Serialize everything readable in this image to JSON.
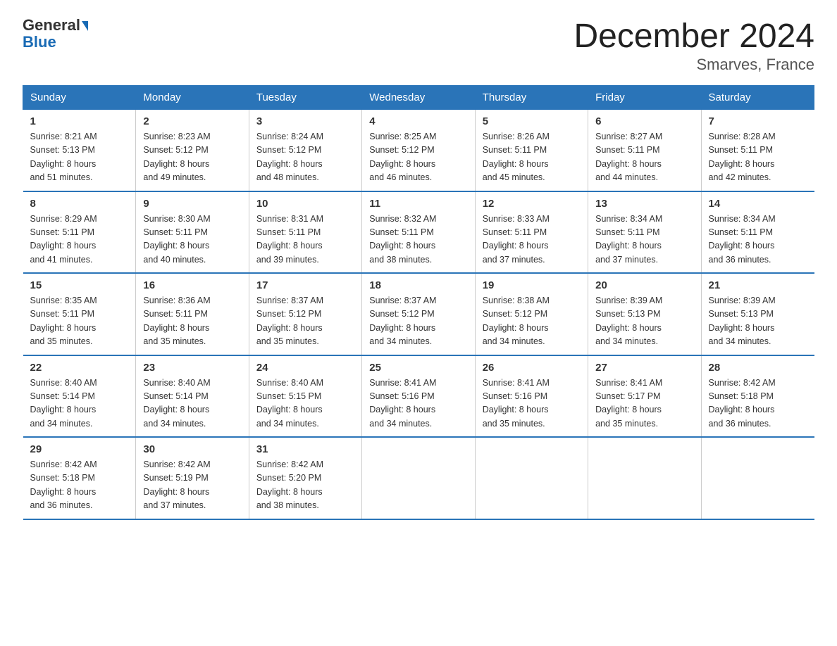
{
  "logo": {
    "line1": "General",
    "line2": "Blue"
  },
  "title": "December 2024",
  "subtitle": "Smarves, France",
  "days_of_week": [
    "Sunday",
    "Monday",
    "Tuesday",
    "Wednesday",
    "Thursday",
    "Friday",
    "Saturday"
  ],
  "weeks": [
    [
      {
        "num": "1",
        "sunrise": "8:21 AM",
        "sunset": "5:13 PM",
        "daylight": "8 hours and 51 minutes."
      },
      {
        "num": "2",
        "sunrise": "8:23 AM",
        "sunset": "5:12 PM",
        "daylight": "8 hours and 49 minutes."
      },
      {
        "num": "3",
        "sunrise": "8:24 AM",
        "sunset": "5:12 PM",
        "daylight": "8 hours and 48 minutes."
      },
      {
        "num": "4",
        "sunrise": "8:25 AM",
        "sunset": "5:12 PM",
        "daylight": "8 hours and 46 minutes."
      },
      {
        "num": "5",
        "sunrise": "8:26 AM",
        "sunset": "5:11 PM",
        "daylight": "8 hours and 45 minutes."
      },
      {
        "num": "6",
        "sunrise": "8:27 AM",
        "sunset": "5:11 PM",
        "daylight": "8 hours and 44 minutes."
      },
      {
        "num": "7",
        "sunrise": "8:28 AM",
        "sunset": "5:11 PM",
        "daylight": "8 hours and 42 minutes."
      }
    ],
    [
      {
        "num": "8",
        "sunrise": "8:29 AM",
        "sunset": "5:11 PM",
        "daylight": "8 hours and 41 minutes."
      },
      {
        "num": "9",
        "sunrise": "8:30 AM",
        "sunset": "5:11 PM",
        "daylight": "8 hours and 40 minutes."
      },
      {
        "num": "10",
        "sunrise": "8:31 AM",
        "sunset": "5:11 PM",
        "daylight": "8 hours and 39 minutes."
      },
      {
        "num": "11",
        "sunrise": "8:32 AM",
        "sunset": "5:11 PM",
        "daylight": "8 hours and 38 minutes."
      },
      {
        "num": "12",
        "sunrise": "8:33 AM",
        "sunset": "5:11 PM",
        "daylight": "8 hours and 37 minutes."
      },
      {
        "num": "13",
        "sunrise": "8:34 AM",
        "sunset": "5:11 PM",
        "daylight": "8 hours and 37 minutes."
      },
      {
        "num": "14",
        "sunrise": "8:34 AM",
        "sunset": "5:11 PM",
        "daylight": "8 hours and 36 minutes."
      }
    ],
    [
      {
        "num": "15",
        "sunrise": "8:35 AM",
        "sunset": "5:11 PM",
        "daylight": "8 hours and 35 minutes."
      },
      {
        "num": "16",
        "sunrise": "8:36 AM",
        "sunset": "5:11 PM",
        "daylight": "8 hours and 35 minutes."
      },
      {
        "num": "17",
        "sunrise": "8:37 AM",
        "sunset": "5:12 PM",
        "daylight": "8 hours and 35 minutes."
      },
      {
        "num": "18",
        "sunrise": "8:37 AM",
        "sunset": "5:12 PM",
        "daylight": "8 hours and 34 minutes."
      },
      {
        "num": "19",
        "sunrise": "8:38 AM",
        "sunset": "5:12 PM",
        "daylight": "8 hours and 34 minutes."
      },
      {
        "num": "20",
        "sunrise": "8:39 AM",
        "sunset": "5:13 PM",
        "daylight": "8 hours and 34 minutes."
      },
      {
        "num": "21",
        "sunrise": "8:39 AM",
        "sunset": "5:13 PM",
        "daylight": "8 hours and 34 minutes."
      }
    ],
    [
      {
        "num": "22",
        "sunrise": "8:40 AM",
        "sunset": "5:14 PM",
        "daylight": "8 hours and 34 minutes."
      },
      {
        "num": "23",
        "sunrise": "8:40 AM",
        "sunset": "5:14 PM",
        "daylight": "8 hours and 34 minutes."
      },
      {
        "num": "24",
        "sunrise": "8:40 AM",
        "sunset": "5:15 PM",
        "daylight": "8 hours and 34 minutes."
      },
      {
        "num": "25",
        "sunrise": "8:41 AM",
        "sunset": "5:16 PM",
        "daylight": "8 hours and 34 minutes."
      },
      {
        "num": "26",
        "sunrise": "8:41 AM",
        "sunset": "5:16 PM",
        "daylight": "8 hours and 35 minutes."
      },
      {
        "num": "27",
        "sunrise": "8:41 AM",
        "sunset": "5:17 PM",
        "daylight": "8 hours and 35 minutes."
      },
      {
        "num": "28",
        "sunrise": "8:42 AM",
        "sunset": "5:18 PM",
        "daylight": "8 hours and 36 minutes."
      }
    ],
    [
      {
        "num": "29",
        "sunrise": "8:42 AM",
        "sunset": "5:18 PM",
        "daylight": "8 hours and 36 minutes."
      },
      {
        "num": "30",
        "sunrise": "8:42 AM",
        "sunset": "5:19 PM",
        "daylight": "8 hours and 37 minutes."
      },
      {
        "num": "31",
        "sunrise": "8:42 AM",
        "sunset": "5:20 PM",
        "daylight": "8 hours and 38 minutes."
      },
      null,
      null,
      null,
      null
    ]
  ],
  "labels": {
    "sunrise": "Sunrise:",
    "sunset": "Sunset:",
    "daylight": "Daylight:"
  }
}
